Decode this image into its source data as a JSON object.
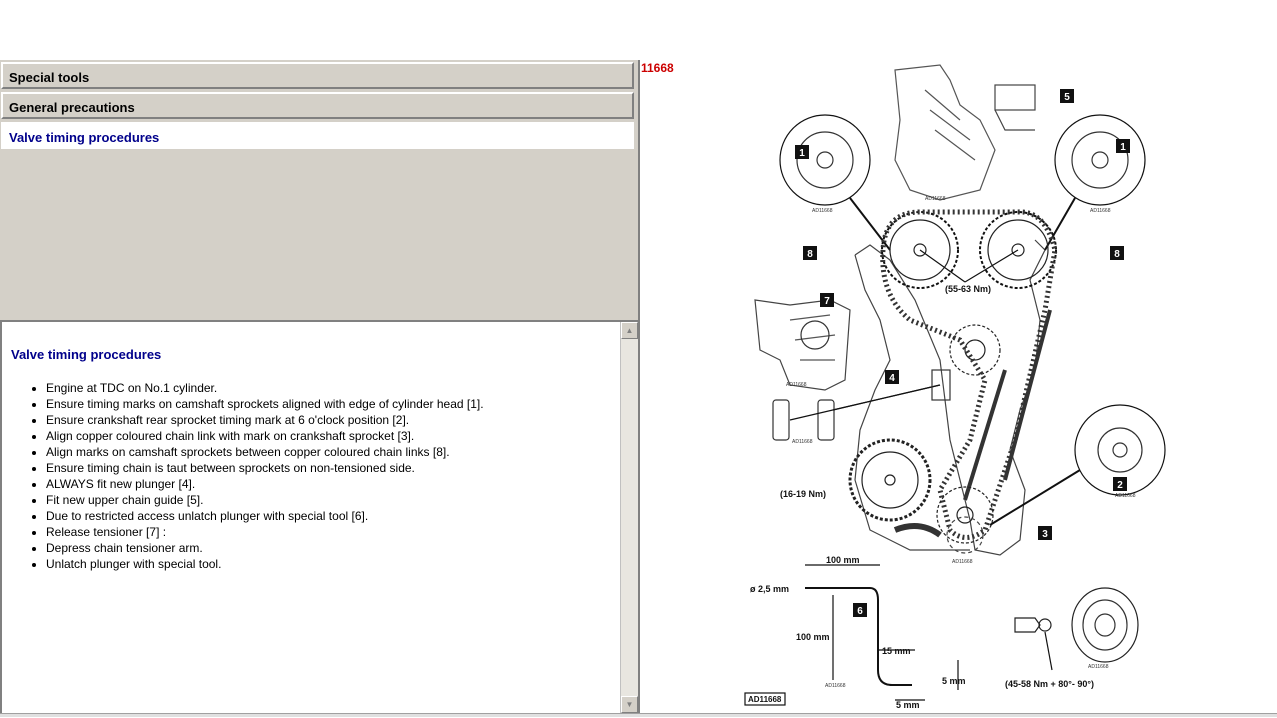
{
  "nav": {
    "special_tools": "Special tools",
    "general_precautions": "General precautions",
    "valve_timing": "Valve timing procedures"
  },
  "content": {
    "title": "Valve timing procedures",
    "steps": [
      "Engine at TDC on No.1 cylinder.",
      "Ensure timing marks on camshaft sprockets aligned with edge of cylinder head [1].",
      "Ensure crankshaft rear sprocket timing mark at 6 o'clock position [2].",
      "Align copper coloured chain link with mark on crankshaft sprocket [3].",
      "Align marks on camshaft sprockets between copper coloured chain links [8].",
      "Ensure timing chain is taut between sprockets on non-tensioned side.",
      "ALWAYS fit new plunger [4].",
      "Fit new upper chain guide [5].",
      "Due to restricted access unlatch plunger with special tool [6].",
      "Release tensioner [7] :",
      "Depress chain tensioner arm.",
      "Unlatch plunger with special tool."
    ]
  },
  "figure": {
    "id": "11668",
    "ref": "AD11668",
    "small_ref": "AD11668",
    "callouts": {
      "c1": "1",
      "c2": "2",
      "c3": "3",
      "c4": "4",
      "c5": "5",
      "c6": "6",
      "c7": "7",
      "c8": "8"
    },
    "torque_cam": "(55-63 Nm)",
    "torque_idler": "(16-19 Nm)",
    "torque_crank": "(45-58 Nm + 80°- 90°)",
    "dim_100_h": "100 mm",
    "dim_100_v": "100 mm",
    "dim_dia": "ø 2,5 mm",
    "dim_15": "15 mm",
    "dim_5a": "5 mm",
    "dim_5b": "5 mm"
  },
  "scrollbar": {
    "up": "▲",
    "down": "▼"
  }
}
